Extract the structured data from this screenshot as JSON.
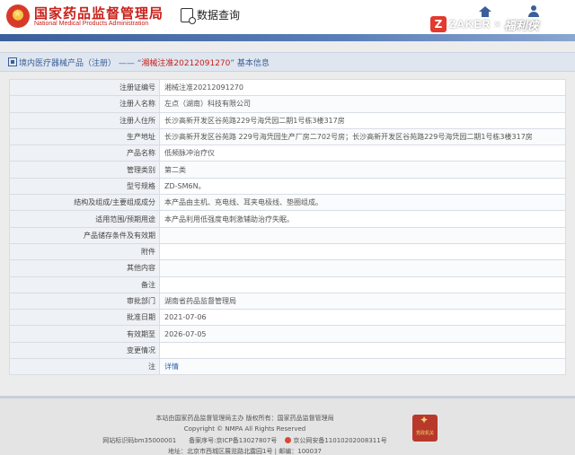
{
  "header": {
    "logo_cn": "国家药品监督管理局",
    "logo_en": "National Medical Products Administration",
    "nav_query": "数据查询"
  },
  "watermark": {
    "badge": "Z",
    "zaker": "ZAKER",
    "x": "×",
    "brand": "福利侠"
  },
  "page": {
    "title_prefix": "境内医疗器械产品（注册） ——  “",
    "title_highlight": "湘械注准20212091270",
    "title_suffix": "” 基本信息"
  },
  "details": [
    {
      "label": "注册证编号",
      "value": "湘械注准20212091270"
    },
    {
      "label": "注册人名称",
      "value": "左点（湖南）科技有限公司"
    },
    {
      "label": "注册人住所",
      "value": "长沙高新开发区谷苑路229号海凭园二期1号栋3楼317房"
    },
    {
      "label": "生产地址",
      "value": "长沙高新开发区谷苑路 229号海凭园生产厂房二702号房；长沙高新开发区谷苑路229号海凭园二期1号栋3楼317房"
    },
    {
      "label": "产品名称",
      "value": "低频脉冲治疗仪"
    },
    {
      "label": "管理类别",
      "value": "第二类"
    },
    {
      "label": "型号规格",
      "value": "ZD-SM6N。"
    },
    {
      "label": "结构及组成/主要组成成分",
      "value": "本产品由主机、充电线、耳夹电极线、垫圈组成。"
    },
    {
      "label": "适用范围/预期用途",
      "value": "本产品利用低强度电刺激辅助治疗失眠。"
    },
    {
      "label": "产品储存条件及有效期",
      "value": ""
    },
    {
      "label": "附件",
      "value": ""
    },
    {
      "label": "其他内容",
      "value": ""
    },
    {
      "label": "备注",
      "value": ""
    },
    {
      "label": "审批部门",
      "value": "湖南省药品监督管理局"
    },
    {
      "label": "批准日期",
      "value": "2021-07-06"
    },
    {
      "label": "有效期至",
      "value": "2026-07-05"
    },
    {
      "label": "变更情况",
      "value": ""
    },
    {
      "label": "注",
      "value": "详情",
      "link": true
    }
  ],
  "footer": {
    "line1": "本站由国家药品监督管理局主办 版权所有：国家药品监督管理局",
    "line2": "Copyright © NMPA All Rights Reserved",
    "line3_a": "网站标识码bm35000001　　备案序号:京ICP备13027807号　",
    "line3_b": "京公网安备11010202008311号",
    "line4": "地址：北京市西城区展览路北露园1号 | 邮编：100037",
    "seal": "党政机关"
  },
  "colors": {
    "brand_red": "#c8211b",
    "nav_blue": "#3b5f9a",
    "link_blue": "#2a61b4"
  }
}
